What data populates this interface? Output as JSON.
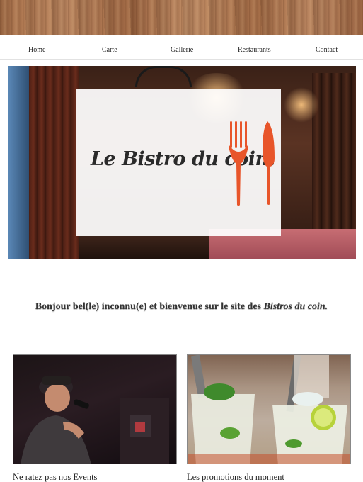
{
  "nav": {
    "items": [
      "Home",
      "Carte",
      "Gallerie",
      "Restaurants",
      "Contact"
    ]
  },
  "hero": {
    "title": "Le Bistro du coin."
  },
  "welcome": {
    "text_before": "Bonjour bel(le) inconnu(e) et bienvenue sur le site des ",
    "emphasis": "Bistros du coin."
  },
  "cards": [
    {
      "title": "Ne ratez pas nos Events",
      "image": "singer-photo"
    },
    {
      "title": "Les promotions du moment",
      "image": "mojito-photo"
    }
  ],
  "colors": {
    "accent": "#e8552a",
    "wood": "#a9724c"
  }
}
